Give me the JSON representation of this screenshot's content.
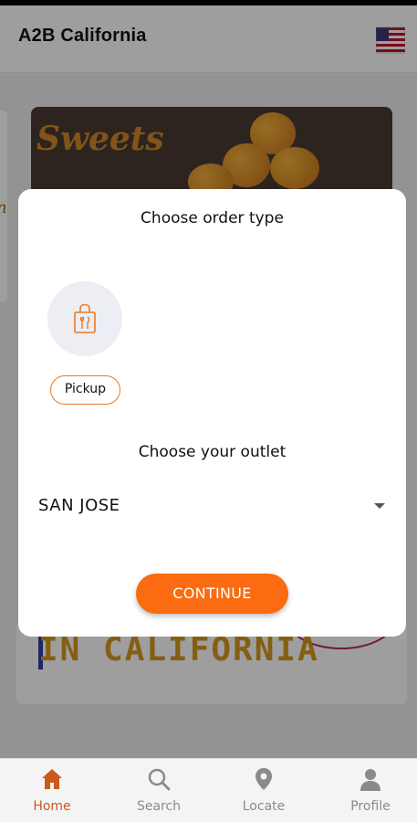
{
  "app": {
    "title": "A2B California",
    "flag_icon": "us-flag-icon"
  },
  "background": {
    "banner_text": "Sweets",
    "side_card_text": "n",
    "card2_text": "IN CALIFORNIA"
  },
  "modal": {
    "title": "Choose order type",
    "order_types": [
      {
        "label": "Pickup",
        "icon": "shopping-bag-icon"
      }
    ],
    "outlet_title": "Choose your outlet",
    "outlet": {
      "selected": "SAN JOSE"
    },
    "continue_label": "CONTINUE"
  },
  "bottom_nav": {
    "items": [
      {
        "label": "Home",
        "icon": "home-icon",
        "active": true
      },
      {
        "label": "Search",
        "icon": "search-icon",
        "active": false
      },
      {
        "label": "Locate",
        "icon": "location-pin-icon",
        "active": false
      },
      {
        "label": "Profile",
        "icon": "person-icon",
        "active": false
      }
    ]
  },
  "colors": {
    "accent": "#fb6b12",
    "nav_active": "#c85a1b",
    "chip_border": "#ea7a25"
  }
}
